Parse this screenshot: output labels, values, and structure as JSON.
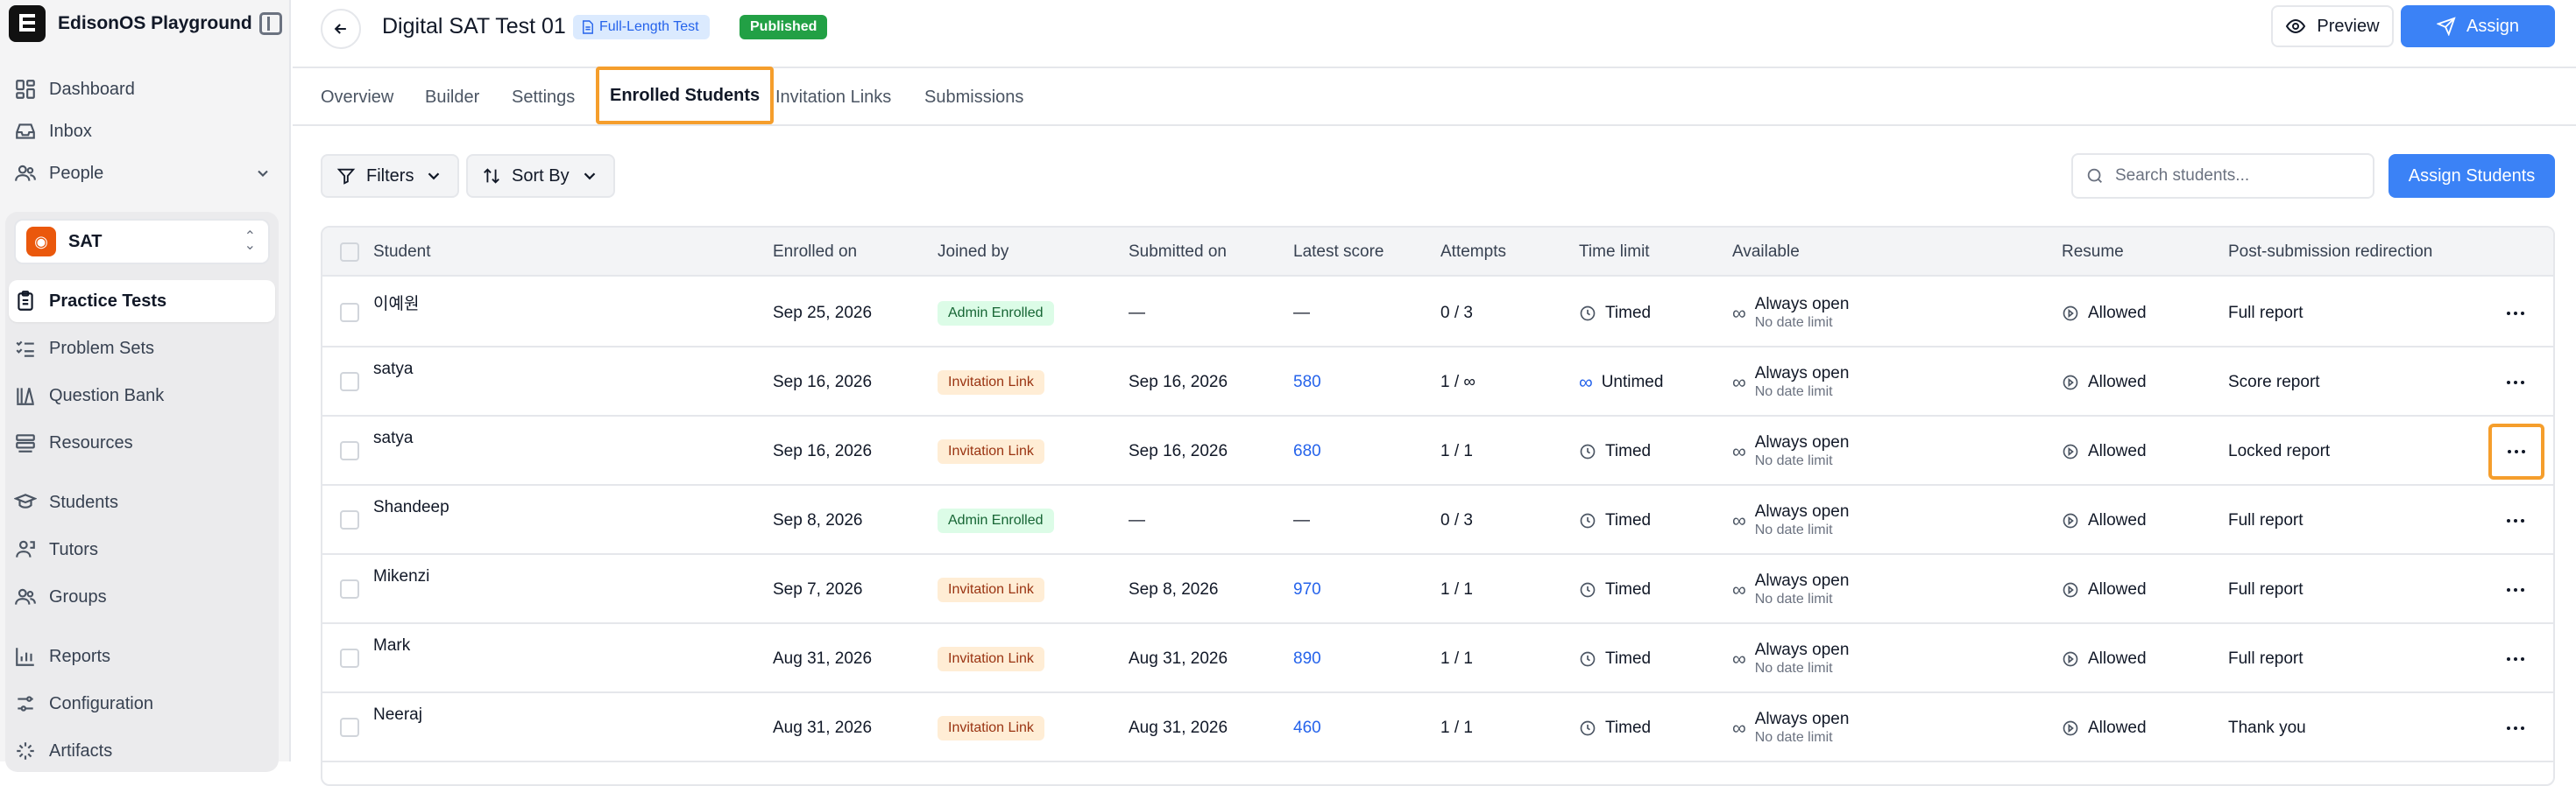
{
  "app": {
    "name": "EdisonOS Playground"
  },
  "nav_top": [
    {
      "label": "Dashboard",
      "icon": "dashboard-icon"
    },
    {
      "label": "Inbox",
      "icon": "inbox-icon"
    },
    {
      "label": "People",
      "icon": "people-icon"
    }
  ],
  "workspace": {
    "name": "SAT",
    "icon": "sat-icon"
  },
  "nav_group": [
    {
      "label": "Practice Tests",
      "icon": "clipboard-icon",
      "active": true
    },
    {
      "label": "Problem Sets",
      "icon": "checklist-icon"
    },
    {
      "label": "Question Bank",
      "icon": "library-icon"
    },
    {
      "label": "Resources",
      "icon": "stack-icon"
    },
    {
      "label": "Students",
      "icon": "student-icon"
    },
    {
      "label": "Tutors",
      "icon": "tutor-icon"
    },
    {
      "label": "Groups",
      "icon": "groups-icon"
    },
    {
      "label": "Reports",
      "icon": "chart-icon"
    },
    {
      "label": "Configuration",
      "icon": "sliders-icon"
    },
    {
      "label": "Artifacts",
      "icon": "artifacts-icon"
    }
  ],
  "header": {
    "title": "Digital SAT Test 01",
    "type_badge": "Full-Length Test",
    "status_badge": "Published",
    "preview_label": "Preview",
    "assign_label": "Assign"
  },
  "tabs": [
    {
      "label": "Overview"
    },
    {
      "label": "Builder"
    },
    {
      "label": "Settings"
    },
    {
      "label": "Enrolled Students",
      "active": true
    },
    {
      "label": "Invitation Links"
    },
    {
      "label": "Submissions"
    }
  ],
  "toolbar": {
    "filters_label": "Filters",
    "sort_label": "Sort By",
    "search_placeholder": "Search students...",
    "search_value": "",
    "assign_students_label": "Assign Students"
  },
  "table": {
    "columns": [
      "Student",
      "Enrolled on",
      "Joined by",
      "Submitted on",
      "Latest score",
      "Attempts",
      "Time limit",
      "Available",
      "Resume",
      "Post-submission redirection"
    ],
    "rows": [
      {
        "student": "이예원",
        "enrolled": "Sep 25, 2026",
        "joined": "Admin Enrolled",
        "joined_type": "admin",
        "submitted": "—",
        "score": "—",
        "attempts": "0 / 3",
        "time": "Timed",
        "time_type": "timed",
        "available": "Always open",
        "available_sub": "No date limit",
        "resume": "Allowed",
        "redirect": "Full report"
      },
      {
        "student": "satya",
        "enrolled": "Sep 16, 2026",
        "joined": "Invitation Link",
        "joined_type": "invite",
        "submitted": "Sep 16, 2026",
        "score": "580",
        "attempts": "1 / ∞",
        "time": "Untimed",
        "time_type": "untimed",
        "available": "Always open",
        "available_sub": "No date limit",
        "resume": "Allowed",
        "redirect": "Score report"
      },
      {
        "student": "satya",
        "enrolled": "Sep 16, 2026",
        "joined": "Invitation Link",
        "joined_type": "invite",
        "submitted": "Sep 16, 2026",
        "score": "680",
        "attempts": "1 / 1",
        "time": "Timed",
        "time_type": "timed",
        "available": "Always open",
        "available_sub": "No date limit",
        "resume": "Allowed",
        "redirect": "Locked report",
        "highlight": true
      },
      {
        "student": "Shandeep",
        "enrolled": "Sep 8, 2026",
        "joined": "Admin Enrolled",
        "joined_type": "admin",
        "submitted": "—",
        "score": "—",
        "attempts": "0 / 3",
        "time": "Timed",
        "time_type": "timed",
        "available": "Always open",
        "available_sub": "No date limit",
        "resume": "Allowed",
        "redirect": "Full report"
      },
      {
        "student": "Mikenzi",
        "enrolled": "Sep 7, 2026",
        "joined": "Invitation Link",
        "joined_type": "invite",
        "submitted": "Sep 8, 2026",
        "score": "970",
        "attempts": "1 / 1",
        "time": "Timed",
        "time_type": "timed",
        "available": "Always open",
        "available_sub": "No date limit",
        "resume": "Allowed",
        "redirect": "Full report"
      },
      {
        "student": "Mark",
        "enrolled": "Aug 31, 2026",
        "joined": "Invitation Link",
        "joined_type": "invite",
        "submitted": "Aug 31, 2026",
        "score": "890",
        "attempts": "1 / 1",
        "time": "Timed",
        "time_type": "timed",
        "available": "Always open",
        "available_sub": "No date limit",
        "resume": "Allowed",
        "redirect": "Full report"
      },
      {
        "student": "Neeraj",
        "enrolled": "Aug 31, 2026",
        "joined": "Invitation Link",
        "joined_type": "invite",
        "submitted": "Aug 31, 2026",
        "score": "460",
        "attempts": "1 / 1",
        "time": "Timed",
        "time_type": "timed",
        "available": "Always open",
        "available_sub": "No date limit",
        "resume": "Allowed",
        "redirect": "Thank you"
      }
    ]
  },
  "colors": {
    "accent": "#3b82f6",
    "highlight": "#f59e2c",
    "published": "#22a045",
    "workspace": "#ea580c"
  }
}
